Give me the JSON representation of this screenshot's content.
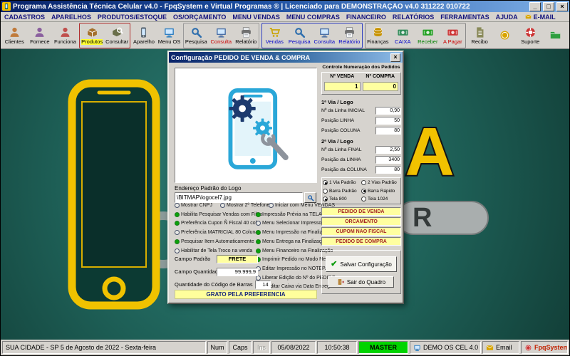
{
  "window": {
    "title": "Programa Assistência Técnica Celular v4.0 - FpqSystem e Virtual Programas ® | Licenciado para  DEMONSTRAÇÃO v4.0 311222 010722",
    "minimize": "_",
    "maximize": "□",
    "close": "×"
  },
  "menubar": {
    "items": [
      "CADASTROS",
      "APARELHOS",
      "PRODUTOS/ESTOQUE",
      "OS/ORÇAMENTO",
      "MENU VENDAS",
      "MENU COMPRAS",
      "FINANCEIRO",
      "RELATÓRIOS",
      "FERRAMENTAS",
      "AJUDA",
      "E-MAIL"
    ]
  },
  "toolbar": {
    "buttons": [
      {
        "label": "Clientes",
        "icon": "person-icon",
        "color": "#c07a3a",
        "labelColor": "#000000"
      },
      {
        "label": "Fornece",
        "icon": "person-icon",
        "color": "#8a5f9e",
        "labelColor": "#000000"
      },
      {
        "label": "Funciona",
        "icon": "person-icon",
        "color": "#c0504d",
        "labelColor": "#000000"
      },
      {
        "label": "Produtos",
        "icon": "box-icon",
        "color": "#a4702c",
        "labelColor": "#000000",
        "labelBg": "#ffff33",
        "group": "products"
      },
      {
        "label": "Consultar",
        "icon": "searchbox-icon",
        "color": "#6a6f4a",
        "labelColor": "#000000",
        "group": "products"
      },
      {
        "label": "Aparelho",
        "icon": "phone-icon",
        "color": "#5f6c77",
        "labelColor": "#000000"
      },
      {
        "label": "Menu OS",
        "icon": "monitor-icon",
        "color": "#2f7fc1",
        "labelColor": "#000000"
      },
      {
        "label": "Pesquisa",
        "icon": "search-icon",
        "color": "#2f6fae",
        "labelColor": "#000000",
        "group": "os"
      },
      {
        "label": "Consulta",
        "icon": "monitor-icon",
        "color": "#4a6fa5",
        "labelColor": "#cc0000",
        "group": "os"
      },
      {
        "label": "Relatório",
        "icon": "printer-icon",
        "color": "#707070",
        "labelColor": "#000000",
        "group": "os"
      },
      {
        "label": "Vendas",
        "icon": "cart-icon",
        "color": "#caa300",
        "labelColor": "#0000cc",
        "group": "sales"
      },
      {
        "label": "Pesquisa",
        "icon": "search-icon",
        "color": "#2f6fae",
        "labelColor": "#0000cc",
        "group": "sales"
      },
      {
        "label": "Consulta",
        "icon": "monitor-icon",
        "color": "#4a6fa5",
        "labelColor": "#0000cc",
        "group": "sales"
      },
      {
        "label": "Relatório",
        "icon": "printer-icon",
        "color": "#707070",
        "labelColor": "#0000cc",
        "group": "sales"
      },
      {
        "label": "Finanças",
        "icon": "coins-icon",
        "color": "#c79200",
        "labelColor": "#000000",
        "group": "fin"
      },
      {
        "label": "CAIXA",
        "icon": "cash-icon",
        "color": "#2e8b57",
        "labelColor": "#0000cc",
        "group": "fin"
      },
      {
        "label": "Receber",
        "icon": "cash-icon",
        "color": "#22a022",
        "labelColor": "#008000",
        "group": "fin"
      },
      {
        "label": "A Pagar",
        "icon": "cash-icon",
        "color": "#cc3333",
        "labelColor": "#cc0000",
        "group": "fin"
      },
      {
        "label": "Recibo",
        "icon": "doc-icon",
        "color": "#8a8a5a",
        "labelColor": "#000000"
      },
      {
        "label": "",
        "icon": "coin-icon",
        "color": "#d8a400",
        "labelColor": "#000000"
      },
      {
        "label": "Suporte",
        "icon": "support-icon",
        "color": "#cc3333",
        "labelColor": "#000000"
      },
      {
        "label": "",
        "icon": "folder-icon",
        "color": "#2e9e3e",
        "labelColor": "#000000"
      }
    ]
  },
  "dialog": {
    "title": "Configuração PEDIDO DE VENDA & COMPRA",
    "close": "×",
    "logo": {
      "label": "Endereço Padrão do Logo",
      "path": "\\BITMAP\\logocel7.jpg"
    },
    "options_col1": [
      {
        "label": "Mostrar CNPJ",
        "checked": false
      },
      {
        "label": "Habilita Pesquisar Vendas com Filtro",
        "checked": true
      },
      {
        "label": "Preferência Cupon Ñ Fiscal 40 col",
        "checked": true
      },
      {
        "label": "Preferência MATRICIAL 80 Colunas",
        "checked": false
      },
      {
        "label": "Pesquisar Item Automaticamente",
        "checked": true
      },
      {
        "label": "Habilitar de Tela Troco na venda",
        "checked": false
      }
    ],
    "options_col2": [
      {
        "label": "Mostrar 2º Telefone",
        "checked": false
      },
      {
        "label": "Impressão Prévia na TELA",
        "checked": true
      },
      {
        "label": "Menu Selecionar Impressora",
        "checked": false
      },
      {
        "label": "Menu Impressão na Finalização",
        "checked": true
      },
      {
        "label": "Menu Entrega na Finalização",
        "checked": true
      },
      {
        "label": "Menu Financeiro na Finalização",
        "checked": true
      },
      {
        "label": "Imprimir Pedido no Modo Negrito",
        "checked": true
      },
      {
        "label": "Editar Impressão no NOTEPAD",
        "checked": false
      },
      {
        "label": "Liberar Edição do Nº do PEDIDO",
        "checked": false
      },
      {
        "label": "Creditar Caixa via Data Entrega",
        "checked": false
      }
    ],
    "option_top_right": {
      "label": "Iniciar com Menu VENDAS",
      "checked": false
    },
    "fields": {
      "campo_padrao_label": "Campo Padrão",
      "campo_padrao_value": "FRETE",
      "campo_qtd_label": "Campo Quantidade",
      "campo_qtd_value": "99.999,9",
      "barcode_label": "Quantidade do Código de Barras",
      "barcode_value": "14",
      "thanks": "GRATO PELA PREFERENCIA"
    },
    "numbering": {
      "title": "Controle Numeração dos Pedidos",
      "venda_label": "Nº VENDA",
      "compra_label": "Nº COMPRA",
      "venda_value": "1",
      "compra_value": "0"
    },
    "via1": {
      "title": "1ª Via / Logo",
      "rows": [
        {
          "label": "Nº da Linha INICIAL",
          "value": "0,90"
        },
        {
          "label": "Posição LINHA",
          "value": "50"
        },
        {
          "label": "Posição COLUNA",
          "value": "80"
        }
      ]
    },
    "via2": {
      "title": "2ª Via / Logo",
      "rows": [
        {
          "label": "Nº da Linha FINAL",
          "value": "2,50"
        },
        {
          "label": "Posição da LINHA",
          "value": "3400"
        },
        {
          "label": "Posição da COLUNA",
          "value": "80"
        }
      ]
    },
    "radios": [
      [
        {
          "label": "1 Via Padrão",
          "checked": true
        },
        {
          "label": "2 Vias Padrão",
          "checked": false
        }
      ],
      [
        {
          "label": "Barra Padrão",
          "checked": false
        },
        {
          "label": "Barra Rápido",
          "checked": true
        }
      ],
      [
        {
          "label": "Tela 800",
          "checked": true
        },
        {
          "label": "Tela 1024",
          "checked": false
        }
      ]
    ],
    "doc_types": [
      "PEDIDO DE VENDA",
      "ORCAMENTO",
      "CUPOM NAO FISCAL",
      "PEDIDO DE COMPRA"
    ],
    "buttons": {
      "save": "Salvar Configuração",
      "save_check": "✔",
      "exit": "Sair do Quadro"
    }
  },
  "statusbar": {
    "location": "SUA CIDADE - SP  5 de Agosto de 2022 - Sexta-feira",
    "num": "Num",
    "caps": "Caps",
    "ins": "Ins",
    "date": "05/08/2022",
    "time": "10:50:38",
    "master": "MASTER",
    "app": "DEMO OS CEL 4.0",
    "email": "Email",
    "brand": "FpqSystem"
  },
  "colors": {
    "master_bg": "#00d400",
    "accent_yellow": "#ffffa0",
    "title_gradient_start": "#0a246a",
    "title_gradient_end": "#8fbce8",
    "doc_text": "#a52525",
    "art_yellow": "#f2c200"
  }
}
